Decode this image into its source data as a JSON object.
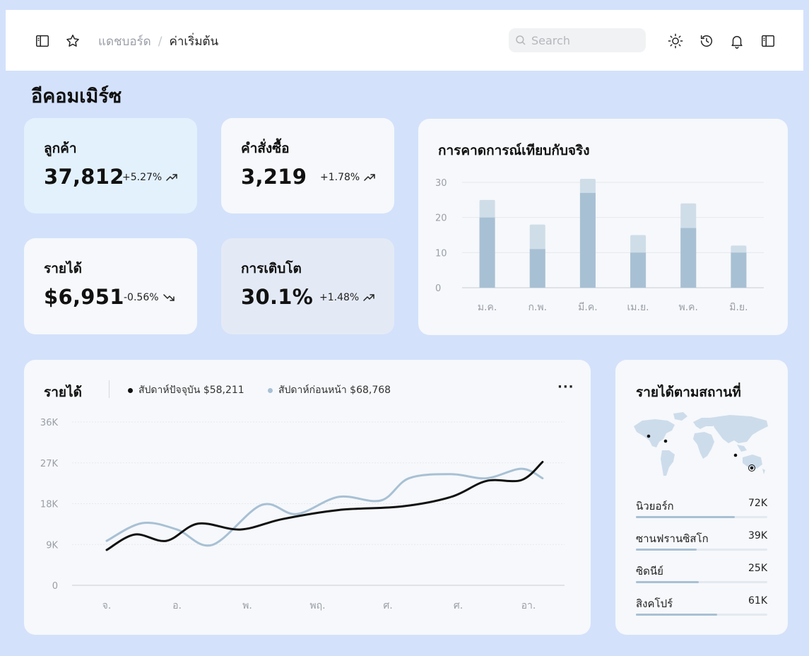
{
  "header": {
    "breadcrumb_parent": "แดชบอร์ด",
    "breadcrumb_separator": "/",
    "breadcrumb_current": "ค่าเริ่มต้น",
    "search_placeholder": "Search"
  },
  "page": {
    "title": "อีคอมเมิร์ซ"
  },
  "kpis": [
    {
      "label": "ลูกค้า",
      "value": "37,812",
      "change": "+5.27%",
      "trend": "up"
    },
    {
      "label": "คำสั่งซื้อ",
      "value": "3,219",
      "change": "+1.78%",
      "trend": "up"
    },
    {
      "label": "รายได้",
      "value": "$6,951",
      "change": "-0.56%",
      "trend": "down"
    },
    {
      "label": "การเติบโต",
      "value": "30.1%",
      "change": "+1.48%",
      "trend": "up"
    }
  ],
  "forecast": {
    "title": "การคาดการณ์เทียบกับจริง",
    "chart_data": {
      "type": "bar",
      "categories": [
        "ม.ค.",
        "ก.พ.",
        "มี.ค.",
        "เม.ย.",
        "พ.ค.",
        "มิ.ย."
      ],
      "series": [
        {
          "values": [
            20,
            11,
            27,
            10,
            17,
            10
          ]
        },
        {
          "values": [
            25,
            18,
            31,
            15,
            24,
            12
          ]
        }
      ],
      "yticks": [
        "0",
        "10",
        "20",
        "30"
      ],
      "ylim": [
        0,
        30
      ],
      "grid": true
    }
  },
  "revenue": {
    "title": "รายได้",
    "legend_current": "สัปดาห์ปัจจุบัน $58,211",
    "legend_previous": "สัปดาห์ก่อนหน้า $68,768",
    "more_label": "···",
    "chart_data": {
      "type": "line",
      "x": [
        "จ.",
        "อ.",
        "พ.",
        "พฤ.",
        "ศ.",
        "ศ.",
        "อา."
      ],
      "yticks": [
        "0",
        "9K",
        "18K",
        "27K",
        "36K"
      ],
      "ylim": [
        0,
        36000
      ],
      "grid": true,
      "series": [
        {
          "name": "สัปดาห์ปัจจุบัน",
          "color": "#111111",
          "x": [
            0.0,
            0.4,
            0.85,
            1.3,
            1.9,
            2.5,
            3.3,
            4.2,
            4.9,
            5.4,
            5.9,
            6.2
          ],
          "values": [
            7800,
            11200,
            9800,
            13600,
            12300,
            14600,
            16600,
            17400,
            19500,
            23000,
            23200,
            27200
          ]
        },
        {
          "name": "สัปดาห์ก่อนหน้า",
          "color": "#a8c0d4",
          "x": [
            0.0,
            0.5,
            1.0,
            1.5,
            2.2,
            2.7,
            3.3,
            3.9,
            4.3,
            4.9,
            5.4,
            5.9,
            6.2
          ],
          "values": [
            9800,
            13700,
            12300,
            8900,
            17700,
            15700,
            19500,
            18700,
            23600,
            24500,
            23600,
            25700,
            23600
          ]
        }
      ]
    }
  },
  "locations": {
    "title": "รายได้ตามสถานที่",
    "items": [
      {
        "name": "นิวยอร์ก",
        "value": "72K",
        "fraction": 0.75
      },
      {
        "name": "ซานฟรานซิสโก",
        "value": "39K",
        "fraction": 0.46
      },
      {
        "name": "ซิดนีย์",
        "value": "25K",
        "fraction": 0.48
      },
      {
        "name": "สิงคโปร์",
        "value": "61K",
        "fraction": 0.62
      }
    ]
  },
  "colors": {
    "background": "#d3e1fb",
    "card": "#f6f8fb",
    "card_highlight": "#e3f1fd",
    "card_muted": "#e4eaf5",
    "bar_actual": "#a8c0d4",
    "bar_forecast": "#cfdde8"
  }
}
